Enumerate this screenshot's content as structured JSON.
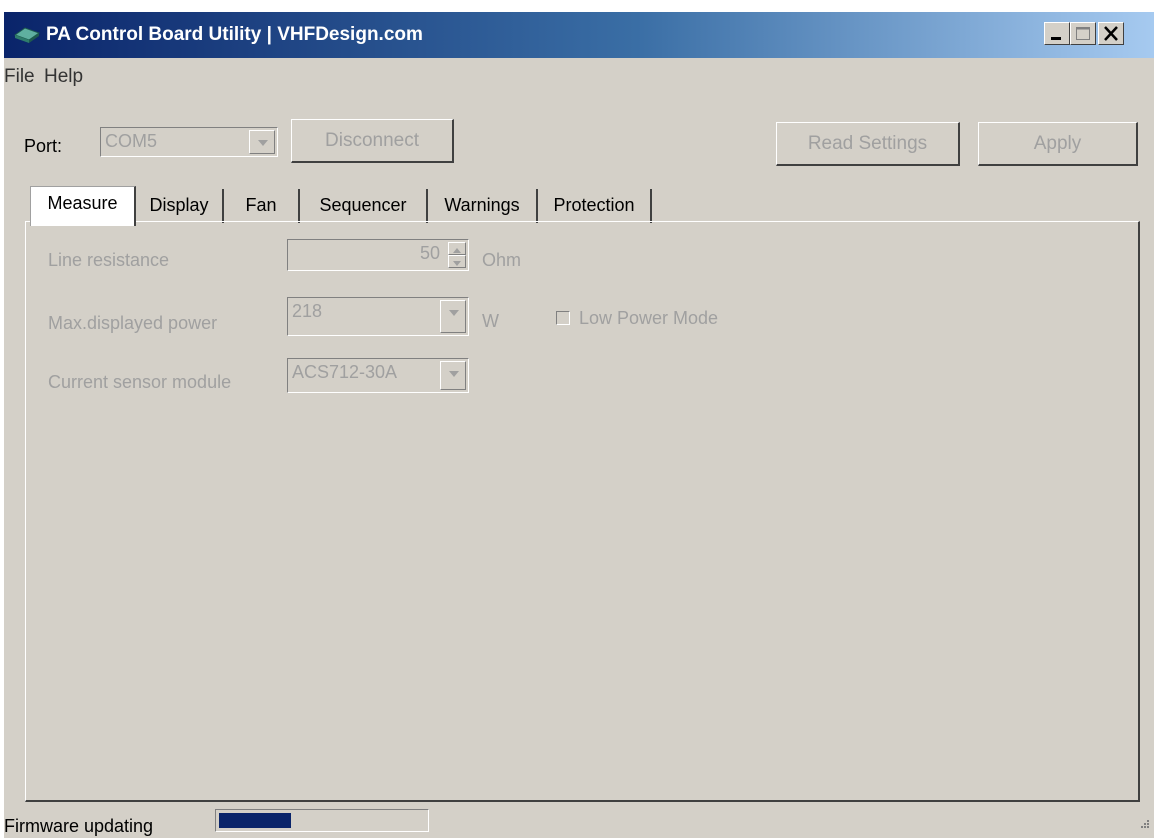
{
  "window": {
    "title": "PA Control Board Utility | VHFDesign.com",
    "minimize_icon": "minimize-icon",
    "maximize_icon": "maximize-icon",
    "close_icon": "close-icon"
  },
  "menu": {
    "items": [
      {
        "label": "File"
      },
      {
        "label": "Help"
      }
    ]
  },
  "toolbar": {
    "port_label": "Port:",
    "port_value": "COM5",
    "disconnect_label": "Disconnect",
    "read_settings_label": "Read Settings",
    "apply_label": "Apply"
  },
  "tabs": [
    {
      "label": "Measure",
      "active": true
    },
    {
      "label": "Display"
    },
    {
      "label": "Fan"
    },
    {
      "label": "Sequencer"
    },
    {
      "label": "Warnings"
    },
    {
      "label": "Protection"
    }
  ],
  "measure": {
    "line_resistance_label": "Line resistance",
    "line_resistance_value": "50",
    "line_resistance_unit": "Ohm",
    "max_power_label": "Max.displayed power",
    "max_power_value": "218",
    "max_power_unit": "W",
    "low_power_mode_label": "Low Power Mode",
    "low_power_mode_checked": false,
    "current_sensor_label": "Current sensor module",
    "current_sensor_value": "ACS712-30A"
  },
  "status": {
    "label": "Firmware updating",
    "progress_fraction": 0.35
  },
  "colors": {
    "window_bg": "#d4d0c8",
    "title_start": "#0a246a",
    "title_end": "#a6caf0",
    "disabled_text": "#a0a0a0",
    "progress": "#0a246a"
  }
}
